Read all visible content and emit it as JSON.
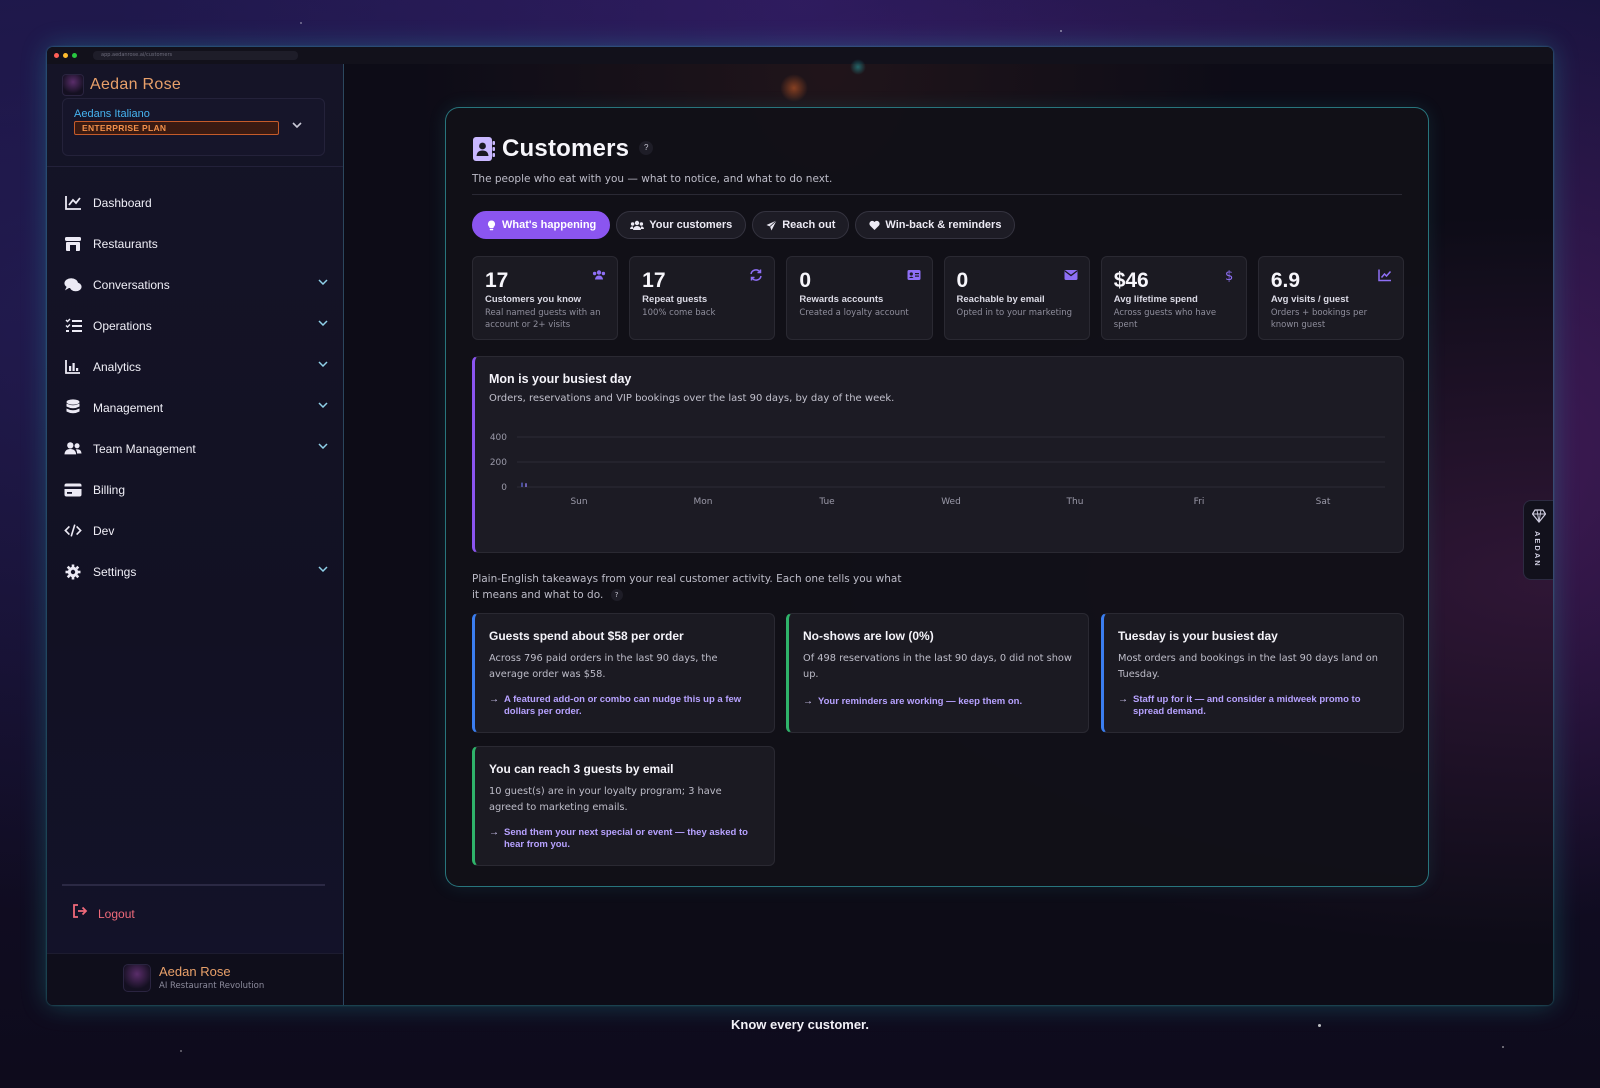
{
  "browser": {
    "url": "app.aedanrose.ai/customers"
  },
  "brand": {
    "name": "Aedan Rose",
    "tagline": "AI Restaurant Revolution"
  },
  "org": {
    "name": "Aedans Italiano",
    "plan": "ENTERPRISE PLAN"
  },
  "nav": [
    {
      "label": "Dashboard",
      "icon": "chart-line-icon",
      "expandable": false
    },
    {
      "label": "Restaurants",
      "icon": "store-icon",
      "expandable": false
    },
    {
      "label": "Conversations",
      "icon": "chat-bubbles-icon",
      "expandable": true
    },
    {
      "label": "Operations",
      "icon": "checklist-icon",
      "expandable": true
    },
    {
      "label": "Analytics",
      "icon": "bar-chart-icon",
      "expandable": true
    },
    {
      "label": "Management",
      "icon": "database-icon",
      "expandable": true
    },
    {
      "label": "Team Management",
      "icon": "users-icon",
      "expandable": true
    },
    {
      "label": "Billing",
      "icon": "credit-card-icon",
      "expandable": false
    },
    {
      "label": "Dev",
      "icon": "code-icon",
      "expandable": false
    },
    {
      "label": "Settings",
      "icon": "gear-icon",
      "expandable": true
    }
  ],
  "logout_label": "Logout",
  "page": {
    "title": "Customers",
    "help": "?",
    "subtitle": "The people who eat with you — what to notice, and what to do next."
  },
  "tabs": [
    {
      "label": "What's happening",
      "icon": "lightbulb-icon",
      "active": true
    },
    {
      "label": "Your customers",
      "icon": "users-icon",
      "active": false
    },
    {
      "label": "Reach out",
      "icon": "paper-plane-icon",
      "active": false
    },
    {
      "label": "Win-back & reminders",
      "icon": "heart-icon",
      "active": false
    }
  ],
  "stats": [
    {
      "value": "17",
      "label": "Customers you know",
      "desc": "Real named guests with an account or 2+ visits",
      "icon": "users-icon"
    },
    {
      "value": "17",
      "label": "Repeat guests",
      "desc": "100% come back",
      "icon": "repeat-icon"
    },
    {
      "value": "0",
      "label": "Rewards accounts",
      "desc": "Created a loyalty account",
      "icon": "id-card-icon"
    },
    {
      "value": "0",
      "label": "Reachable by email",
      "desc": "Opted in to your marketing",
      "icon": "envelope-icon"
    },
    {
      "value": "$46",
      "label": "Avg lifetime spend",
      "desc": "Across guests who have spent",
      "icon": "dollar-icon"
    },
    {
      "value": "6.9",
      "label": "Avg visits / guest",
      "desc": "Orders + bookings per known guest",
      "icon": "trend-chart-icon"
    }
  ],
  "chart_card": {
    "title": "Mon is your busiest day",
    "subtitle": "Orders, reservations and VIP bookings over the last 90 days, by day of the week."
  },
  "chart_data": {
    "type": "bar",
    "title": "Mon is your busiest day",
    "xlabel": "",
    "ylabel": "",
    "categories": [
      "Sun",
      "Mon",
      "Tue",
      "Wed",
      "Thu",
      "Fri",
      "Sat"
    ],
    "series": [
      {
        "values": [
          35,
          0,
          0,
          0,
          0,
          0,
          0
        ],
        "color": "#4a4f9a"
      },
      {
        "values": [
          30,
          0,
          0,
          0,
          0,
          0,
          0
        ],
        "color": "#6b5fb0"
      }
    ],
    "yticks": [
      0,
      200,
      400
    ],
    "ylim": [
      0,
      400
    ],
    "grid": true,
    "colors": {
      "axis_text": "#9a99a8",
      "grid": "#2c2b36"
    }
  },
  "takeaways": {
    "intro": "Plain-English takeaways from your real customer activity. Each one tells you what it means and what to do.",
    "help": "?",
    "items": [
      {
        "title": "Guests spend about $58 per order",
        "body": "Across 796 paid orders in the last 90 days, the average order was $58.",
        "action": "A featured add-on or combo can nudge this up a few dollars per order.",
        "accent": "blue"
      },
      {
        "title": "No-shows are low (0%)",
        "body": "Of 498 reservations in the last 90 days, 0 did not show up.",
        "action": "Your reminders are working — keep them on.",
        "accent": "green"
      },
      {
        "title": "Tuesday is your busiest day",
        "body": "Most orders and bookings in the last 90 days land on Tuesday.",
        "action": "Staff up for it — and consider a midweek promo to spread demand.",
        "accent": "blue"
      },
      {
        "title": "You can reach 3 guests by email",
        "body": "10 guest(s) are in your loyalty program; 3 have agreed to marketing emails.",
        "action": "Send them your next special or event — they asked to hear from you.",
        "accent": "green"
      }
    ]
  },
  "side_tab": {
    "label": "AEDAN",
    "icon": "diamond-icon"
  },
  "caption": "Know every customer."
}
